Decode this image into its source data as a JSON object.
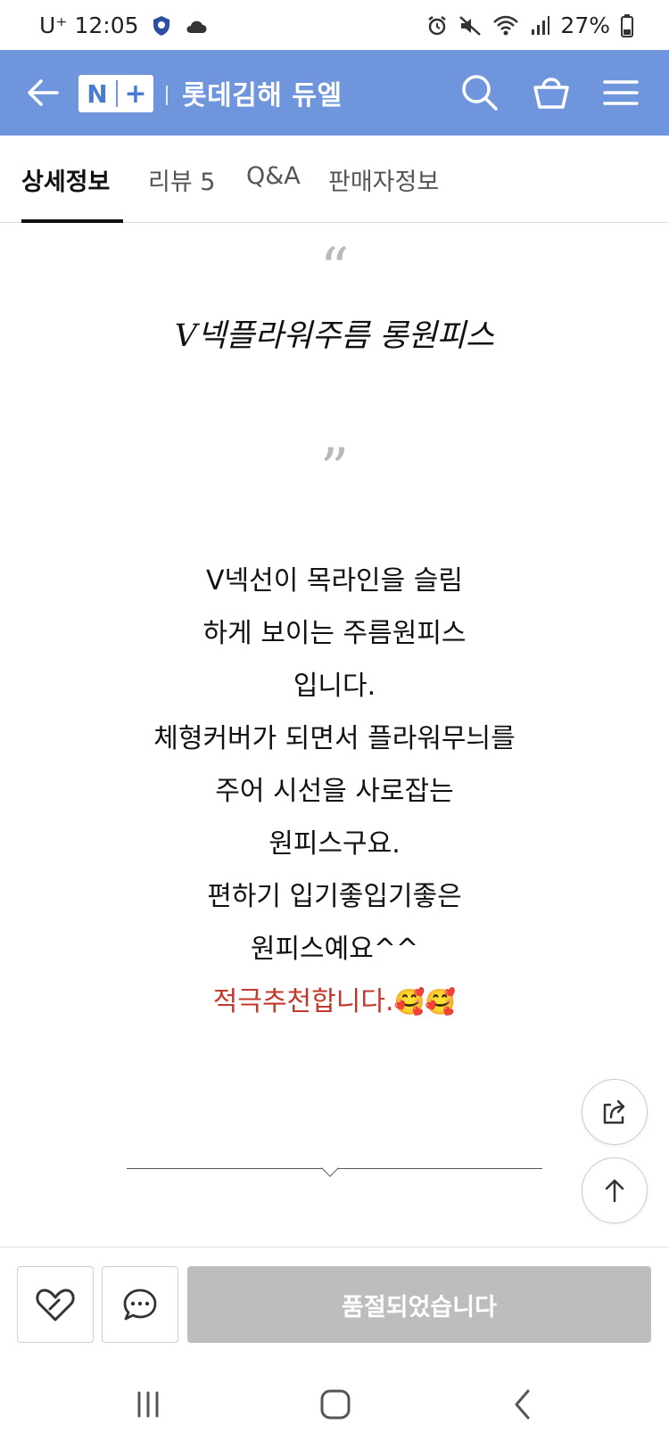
{
  "status_bar": {
    "carrier": "U⁺",
    "time": "12:05",
    "battery": "27%"
  },
  "header": {
    "logo_n": "N",
    "logo_plus": "+",
    "store_name": "롯데김해 듀엘",
    "colors": {
      "background": "#6f96dc"
    }
  },
  "tabs": [
    {
      "label": "상세정보",
      "active": true
    },
    {
      "label": "리뷰 5",
      "active": false
    },
    {
      "label": "Q&A",
      "active": false
    },
    {
      "label": "판매자정보",
      "active": false
    }
  ],
  "content": {
    "quote_open": "“",
    "quote_close": "”",
    "product_title": "V넥플라워주름 롱원피스",
    "description_lines": [
      "V넥선이 목라인을 슬림",
      "하게 보이는 주름원피스",
      "입니다.",
      "체형커버가 되면서 플라워무늬를",
      "주어 시선을 사로잡는",
      "원피스구요.",
      "편하기 입기좋입기좋은",
      "원피스예요^^"
    ],
    "highlight_line": "적극추천합니다.",
    "highlight_emoji": "🥰🥰",
    "highlight_color": "#c0392b"
  },
  "bottom_bar": {
    "soldout_label": "품절되었습니다"
  },
  "icons": {
    "back": "arrow-left-icon",
    "search": "search-icon",
    "cart": "shopping-bag-icon",
    "menu": "hamburger-menu-icon",
    "share": "share-icon",
    "scroll_top": "arrow-up-icon",
    "like": "heart-icon",
    "talk": "chat-bubble-icon"
  }
}
